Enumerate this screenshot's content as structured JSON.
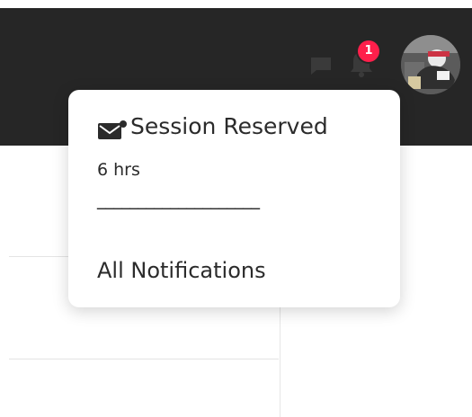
{
  "header": {
    "icons": {
      "chat": "chat-bubble-icon",
      "notifications": "bell-icon"
    },
    "notification_badge_count": "1",
    "colors": {
      "header_bg": "#262626",
      "badge_bg": "#ff1f4b",
      "icon_color": "#3a3a3a"
    }
  },
  "notifications_dropdown": {
    "items": [
      {
        "icon": "mail-notification-icon",
        "title": "Session Reserved",
        "time": "6 hrs"
      }
    ],
    "separator_text": "____________________",
    "all_link_label": "All Notifications"
  }
}
